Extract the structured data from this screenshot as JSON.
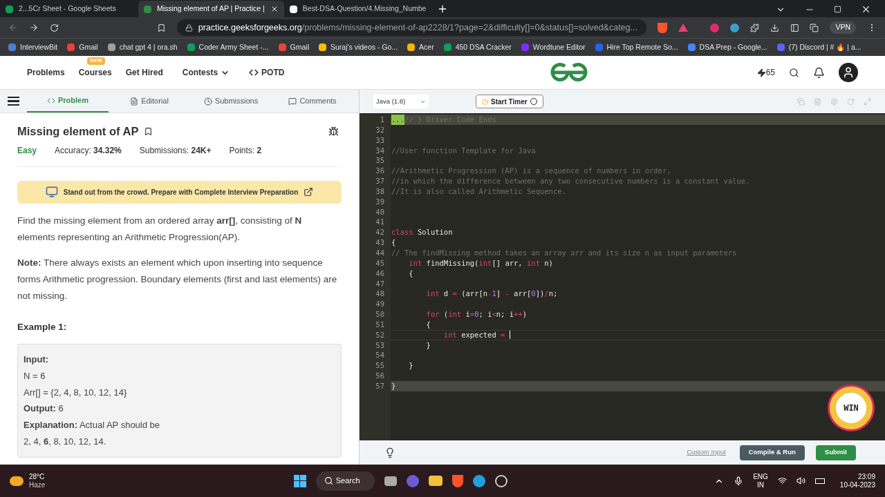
{
  "browser": {
    "tabs": [
      {
        "title": "2...5Cr Sheet - Google Sheets",
        "selected": false,
        "color": "#0f9d58"
      },
      {
        "title": "Missing element of AP | Practice |",
        "selected": true,
        "color": "#2f8d46"
      },
      {
        "title": "Best-DSA-Question/4.Missing_Numbe",
        "selected": false,
        "color": "#ffffff"
      }
    ],
    "address": {
      "domain": "practice.geeksforgeeks.org",
      "path": "/problems/missing-element-of-ap2228/1?page=2&difficulty[]=0&status[]=solved&categ..."
    },
    "vpn": "VPN",
    "bookmarks": [
      {
        "label": "InterviewBit",
        "color": "#4a7fd4"
      },
      {
        "label": "Gmail",
        "color": "#ea4335"
      },
      {
        "label": "chat gpt 4 | ora.sh",
        "color": "#9e9e9e"
      },
      {
        "label": "Coder Army Sheet -...",
        "color": "#0f9d58"
      },
      {
        "label": "Gmail",
        "color": "#ea4335"
      },
      {
        "label": "Suraj's videos - Go...",
        "color": "#fbbc04"
      },
      {
        "label": "Acer",
        "color": "#f4b400"
      },
      {
        "label": "450 DSA Cracker",
        "color": "#0f9d58"
      },
      {
        "label": "Wordtune Editor",
        "color": "#7b2ff7"
      },
      {
        "label": "Hire Top Remote So...",
        "color": "#2563eb"
      },
      {
        "label": "DSA Prep - Google...",
        "color": "#4285f4"
      },
      {
        "label": "(7) Discord | # 🔥 | a...",
        "color": "#5865f2"
      }
    ]
  },
  "site": {
    "nav": [
      {
        "label": "Problems",
        "kind": "plain"
      },
      {
        "label": "Courses",
        "kind": "badge",
        "badge": "SAVE"
      },
      {
        "label": "Get Hired",
        "kind": "plain"
      },
      {
        "label": "Contests",
        "kind": "dropdown"
      },
      {
        "label": "POTD",
        "kind": "code"
      }
    ],
    "streak": "65"
  },
  "problem_tabs": [
    {
      "label": "Problem",
      "selected": true
    },
    {
      "label": "Editorial",
      "selected": false
    },
    {
      "label": "Submissions",
      "selected": false
    },
    {
      "label": "Comments",
      "selected": false
    }
  ],
  "problem": {
    "title": "Missing element of AP",
    "difficulty": "Easy",
    "stats": [
      {
        "label": "Accuracy:",
        "value": "34.32%"
      },
      {
        "label": "Submissions:",
        "value": "24K+"
      },
      {
        "label": "Points:",
        "value": "2"
      }
    ],
    "banner": "Stand out from the crowd. Prepare with Complete Interview Preparation",
    "paragraphs": [
      "Find the missing element from an ordered array **arr[]**, consisting of **N** elements representing an Arithmetic Progression(AP).",
      "**Note:** There always exists an element which upon inserting into sequence forms Arithmetic progression. Boundary elements (first and last elements) are not missing."
    ],
    "example_title": "Example 1:",
    "example_lines": [
      "**Input:**",
      "N = 6",
      "Arr[] = {2, 4, 8, 10, 12, 14}",
      "**Output:** 6",
      "**Explanation:** Actual AP should be",
      "2, 4, **6**, 8, 10, 12, 14."
    ]
  },
  "editor": {
    "language": "Java (1.8)",
    "timer": "Start Timer",
    "lines": [
      {
        "number": "1",
        "highlighted": true,
        "tokens": [
          {
            "kind": "fold",
            "text": "..."
          },
          {
            "kind": "comment",
            "text": "// } Driver Code Ends"
          }
        ]
      },
      {
        "number": "32",
        "highlighted": false
      },
      {
        "number": "33",
        "highlighted": false
      },
      {
        "number": "34",
        "highlighted": false,
        "tokens": [
          {
            "kind": "comment",
            "text": "//User function Template for Java"
          }
        ]
      },
      {
        "number": "35",
        "highlighted": false
      },
      {
        "number": "36",
        "highlighted": false,
        "tokens": [
          {
            "kind": "comment",
            "text": "//Arithmetic Progression (AP) is a sequence of numbers in order,"
          }
        ]
      },
      {
        "number": "37",
        "highlighted": false,
        "tokens": [
          {
            "kind": "comment",
            "text": "//in which the difference between any two consecutive numbers is a constant value."
          }
        ]
      },
      {
        "number": "38",
        "highlighted": false,
        "tokens": [
          {
            "kind": "comment",
            "text": "//It is also called Arithmetic Sequence."
          }
        ]
      },
      {
        "number": "39",
        "highlighted": false
      },
      {
        "number": "40",
        "highlighted": false
      },
      {
        "number": "41",
        "highlighted": false
      },
      {
        "number": "42",
        "highlighted": false,
        "tokens": [
          {
            "kind": "keyword",
            "text": "class"
          },
          {
            "kind": "plain",
            "text": " Solution"
          }
        ]
      },
      {
        "number": "43",
        "highlighted": false,
        "tokens": [
          {
            "kind": "plain",
            "text": "{"
          }
        ]
      },
      {
        "number": "44",
        "highlighted": false,
        "tokens": [
          {
            "kind": "comment",
            "text": "// The findMissing method takes an array arr and its size n as input parameters"
          }
        ]
      },
      {
        "number": "45",
        "highlighted": false,
        "tokens": [
          {
            "kind": "keyword",
            "text": "    int"
          },
          {
            "kind": "plain",
            "text": " findMissing("
          },
          {
            "kind": "keyword",
            "text": "int"
          },
          {
            "kind": "plain",
            "text": "[] arr, "
          },
          {
            "kind": "keyword",
            "text": "int"
          },
          {
            "kind": "plain",
            "text": " n)"
          }
        ]
      },
      {
        "number": "46",
        "highlighted": false,
        "tokens": [
          {
            "kind": "plain",
            "text": "    {"
          }
        ]
      },
      {
        "number": "47",
        "highlighted": false
      },
      {
        "number": "48",
        "highlighted": false,
        "tokens": [
          {
            "kind": "keyword",
            "text": "        int"
          },
          {
            "kind": "plain",
            "text": " d "
          },
          {
            "kind": "keyword",
            "text": "="
          },
          {
            "kind": "plain",
            "text": " (arr[n"
          },
          {
            "kind": "keyword",
            "text": "-"
          },
          {
            "kind": "number",
            "text": "1"
          },
          {
            "kind": "plain",
            "text": "] "
          },
          {
            "kind": "keyword",
            "text": "-"
          },
          {
            "kind": "plain",
            "text": " arr["
          },
          {
            "kind": "number",
            "text": "0"
          },
          {
            "kind": "plain",
            "text": "])"
          },
          {
            "kind": "keyword",
            "text": "/"
          },
          {
            "kind": "plain",
            "text": "n;"
          }
        ]
      },
      {
        "number": "49",
        "highlighted": false
      },
      {
        "number": "50",
        "highlighted": false,
        "tokens": [
          {
            "kind": "keyword",
            "text": "        for"
          },
          {
            "kind": "plain",
            "text": " ("
          },
          {
            "kind": "keyword",
            "text": "int"
          },
          {
            "kind": "plain",
            "text": " i"
          },
          {
            "kind": "keyword",
            "text": "="
          },
          {
            "kind": "number",
            "text": "0"
          },
          {
            "kind": "plain",
            "text": "; i"
          },
          {
            "kind": "keyword",
            "text": "<"
          },
          {
            "kind": "plain",
            "text": "n; i"
          },
          {
            "kind": "keyword",
            "text": "++"
          },
          {
            "kind": "plain",
            "text": ")"
          }
        ]
      },
      {
        "number": "51",
        "highlighted": false,
        "tokens": [
          {
            "kind": "plain",
            "text": "        {"
          }
        ]
      },
      {
        "number": "52",
        "highlighted": false,
        "cursor": true,
        "tokens": [
          {
            "kind": "keyword",
            "text": "            int"
          },
          {
            "kind": "plain",
            "text": " expected "
          },
          {
            "kind": "keyword",
            "text": "= "
          }
        ]
      },
      {
        "number": "53",
        "highlighted": false,
        "tokens": [
          {
            "kind": "plain",
            "text": "        }"
          }
        ]
      },
      {
        "number": "54",
        "highlighted": false
      },
      {
        "number": "55",
        "highlighted": false,
        "tokens": [
          {
            "kind": "plain",
            "text": "    }"
          }
        ]
      },
      {
        "number": "56",
        "highlighted": false
      },
      {
        "number": "57",
        "highlighted": true,
        "tokens": [
          {
            "kind": "plain",
            "text": "}"
          }
        ]
      }
    ],
    "win": "WIN",
    "custom_input": "Custom Input",
    "run": "Compile & Run",
    "submit": "Submit"
  },
  "taskbar": {
    "temperature": "28°C",
    "weather": "Haze",
    "search": "Search",
    "lang": "ENG",
    "region": "IN",
    "time": "23:09",
    "date": "10-04-2023"
  }
}
